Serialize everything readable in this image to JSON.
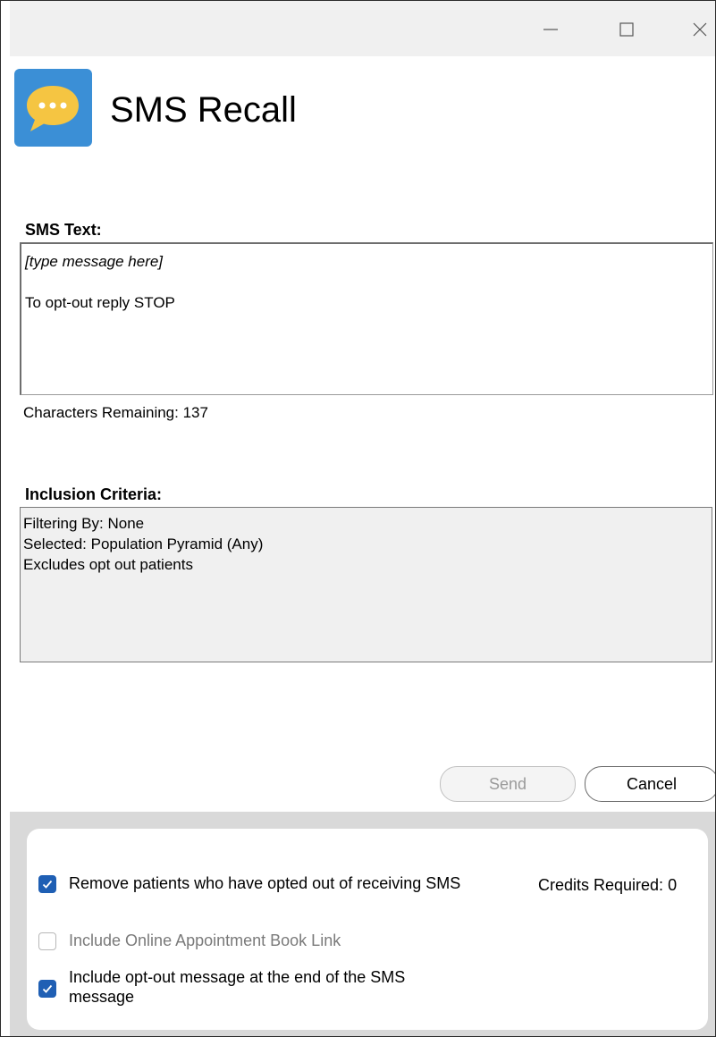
{
  "window": {
    "title": "SMS Recall"
  },
  "sms_text": {
    "label": "SMS Text:",
    "line1": "[type message here]",
    "line2": "To opt-out reply STOP",
    "chars_remaining": "Characters Remaining: 137"
  },
  "inclusion": {
    "label": "Inclusion Criteria:",
    "lines": [
      "Filtering By: None",
      "Selected: Population Pyramid (Any)",
      "Excludes opt out patients"
    ]
  },
  "buttons": {
    "send": "Send",
    "cancel": "Cancel"
  },
  "options": {
    "remove_opted_out": {
      "label": "Remove patients who have opted out of receiving SMS",
      "checked": true
    },
    "online_booking": {
      "label": "Include Online Appointment Book Link",
      "checked": false,
      "enabled": false
    },
    "optout_message": {
      "label_line1": "Include opt-out message at the end of the SMS",
      "label_line2": "message",
      "checked": true
    },
    "credits": "Credits Required: 0"
  },
  "icons": {
    "app": "chat-bubble-icon",
    "minimize": "minimize-icon",
    "maximize": "maximize-icon",
    "close": "close-icon"
  },
  "colors": {
    "app_icon_bg": "#3b8fd6",
    "checkbox_checked": "#1f5fb4",
    "bottom_panel": "#d9d9d9"
  }
}
